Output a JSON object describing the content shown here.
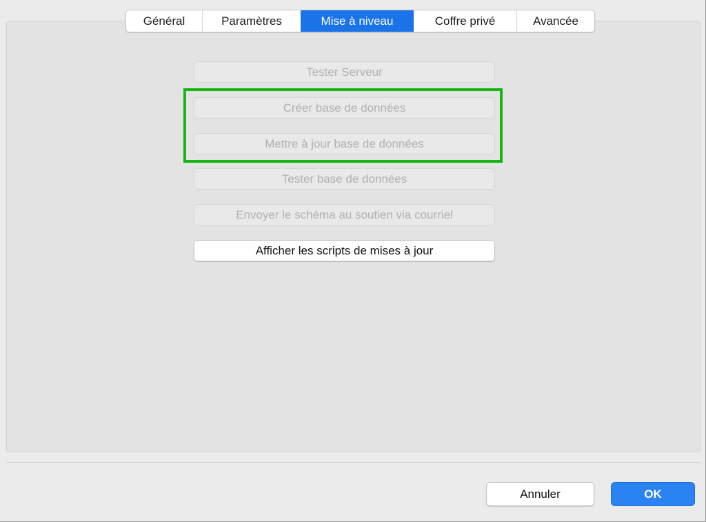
{
  "tabs": [
    {
      "label": "Général",
      "active": false
    },
    {
      "label": "Paramètres",
      "active": false
    },
    {
      "label": "Mise à niveau",
      "active": true
    },
    {
      "label": "Coffre privé",
      "active": false
    },
    {
      "label": "Avancée",
      "active": false
    }
  ],
  "buttons": [
    {
      "label": "Tester Serveur",
      "enabled": false
    },
    {
      "label": "Créer base de données",
      "enabled": false
    },
    {
      "label": "Mettre à jour base de données",
      "enabled": false
    },
    {
      "label": "Tester base de données",
      "enabled": false
    },
    {
      "label": "Envoyer le schéma au soutien via courriel",
      "enabled": false
    },
    {
      "label": "Afficher les scripts de mises à jour",
      "enabled": true
    }
  ],
  "footer": {
    "cancel_label": "Annuler",
    "ok_label": "OK"
  },
  "colors": {
    "accent": "#1a73e8",
    "highlight": "#16b514"
  }
}
